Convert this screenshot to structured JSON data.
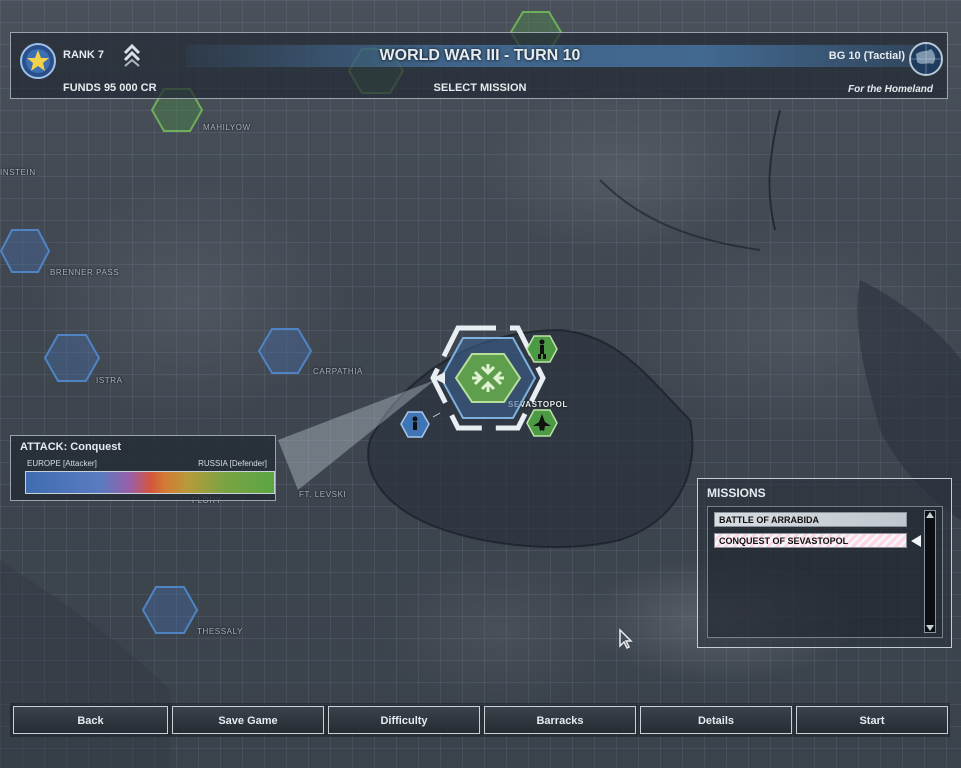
{
  "header": {
    "rank": "RANK 7",
    "funds": "FUNDS 95 000  CR",
    "title": "WORLD WAR III - TURN 10",
    "subtitle": "SELECT MISSION",
    "battlegroup": "BG 10 (Tactial)",
    "faction_motto": "For the Homeland",
    "icons": [
      "rank-star-emblem",
      "rank-chevrons",
      "faction-globe-emblem"
    ]
  },
  "map": {
    "labels": {
      "mahilyow": "MAHILYOW",
      "brenner": "BRENNER PASS",
      "carpathia": "CARPATHIA",
      "sevastopol": "SEVASTOPOL",
      "levski": "FT. LEVSKI",
      "thessaly": "THESSALY",
      "istria": "ISTRA",
      "stein": "INSTEIN",
      "flory": "FLORY"
    }
  },
  "attack": {
    "title": "ATTACK: Conquest",
    "attacker": "EUROPE [Attacker]",
    "defender": "RUSSIA [Defender]"
  },
  "missions": {
    "title": "MISSIONS",
    "items": [
      "BATTLE OF ARRABIDA",
      "CONQUEST OF SEVASTOPOL"
    ],
    "selected_index": 1
  },
  "buttons": {
    "back": "Back",
    "save": "Save Game",
    "difficulty": "Difficulty",
    "barracks": "Barracks",
    "details": "Details",
    "start": "Start"
  },
  "colors": {
    "europe_blue": "#3f6db0",
    "russia_green": "#5ca543",
    "panel_border": "#9aa4ae"
  }
}
